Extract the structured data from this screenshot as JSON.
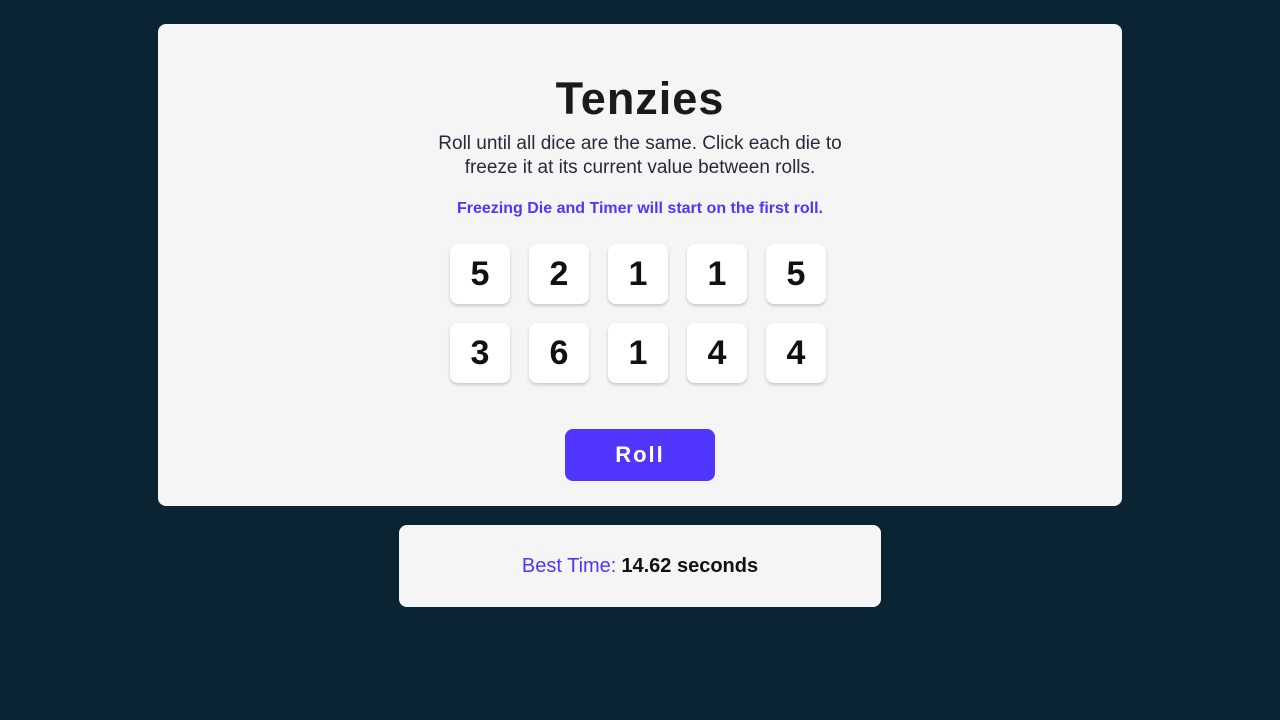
{
  "game": {
    "title": "Tenzies",
    "instructions": "Roll until all dice are the same. Click each die to freeze it at its current value between rolls.",
    "hint": "Freezing Die and Timer will start on the first roll.",
    "dice": [
      "5",
      "2",
      "1",
      "1",
      "5",
      "3",
      "6",
      "1",
      "4",
      "4"
    ],
    "roll_label": "Roll"
  },
  "best_time": {
    "label": "Best Time:",
    "value": "14.62 seconds"
  },
  "colors": {
    "background": "#0b2434",
    "card": "#f5f5f5",
    "accent": "#5035ff"
  }
}
